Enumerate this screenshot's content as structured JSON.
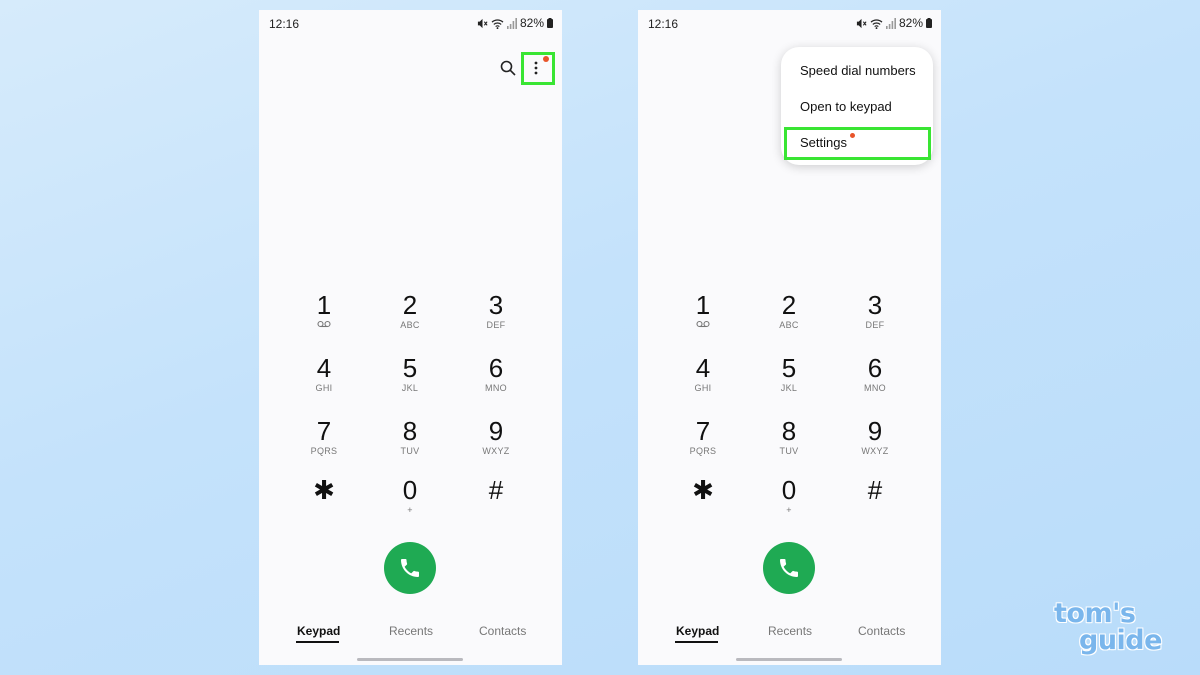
{
  "left_screen": {
    "status": {
      "time": "12:16",
      "battery": "82%"
    },
    "keys": [
      {
        "digit": "1",
        "letters": ""
      },
      {
        "digit": "2",
        "letters": "ABC"
      },
      {
        "digit": "3",
        "letters": "DEF"
      },
      {
        "digit": "4",
        "letters": "GHI"
      },
      {
        "digit": "5",
        "letters": "JKL"
      },
      {
        "digit": "6",
        "letters": "MNO"
      },
      {
        "digit": "7",
        "letters": "PQRS"
      },
      {
        "digit": "8",
        "letters": "TUV"
      },
      {
        "digit": "9",
        "letters": "WXYZ"
      },
      {
        "digit": "✱",
        "letters": ""
      },
      {
        "digit": "0",
        "letters": "+"
      },
      {
        "digit": "#",
        "letters": ""
      }
    ],
    "tabs": [
      "Keypad",
      "Recents",
      "Contacts"
    ],
    "active_tab": "Keypad"
  },
  "right_screen": {
    "status": {
      "time": "12:16",
      "battery": "82%"
    },
    "menu": {
      "items": [
        "Speed dial numbers",
        "Open to keypad",
        "Settings"
      ],
      "highlighted": "Settings"
    },
    "keys": [
      {
        "digit": "1",
        "letters": ""
      },
      {
        "digit": "2",
        "letters": "ABC"
      },
      {
        "digit": "3",
        "letters": "DEF"
      },
      {
        "digit": "4",
        "letters": "GHI"
      },
      {
        "digit": "5",
        "letters": "JKL"
      },
      {
        "digit": "6",
        "letters": "MNO"
      },
      {
        "digit": "7",
        "letters": "PQRS"
      },
      {
        "digit": "8",
        "letters": "TUV"
      },
      {
        "digit": "9",
        "letters": "WXYZ"
      },
      {
        "digit": "✱",
        "letters": ""
      },
      {
        "digit": "0",
        "letters": "+"
      },
      {
        "digit": "#",
        "letters": ""
      }
    ],
    "tabs": [
      "Keypad",
      "Recents",
      "Contacts"
    ],
    "active_tab": "Keypad"
  },
  "brand": {
    "line1": "tom's",
    "line2": "guide"
  },
  "icons": {
    "search": "search-icon",
    "more": "more-vertical-icon",
    "call": "phone-icon",
    "voicemail": "voicemail-icon",
    "mute": "mute-icon",
    "wifi": "wifi-icon",
    "signal": "signal-icon",
    "battery": "battery-icon"
  },
  "colors": {
    "background": "#c4e2fb",
    "highlight": "#39e533",
    "call_button": "#1faa53",
    "notification_dot": "#e8542a",
    "brand": "#7ab6ec"
  }
}
